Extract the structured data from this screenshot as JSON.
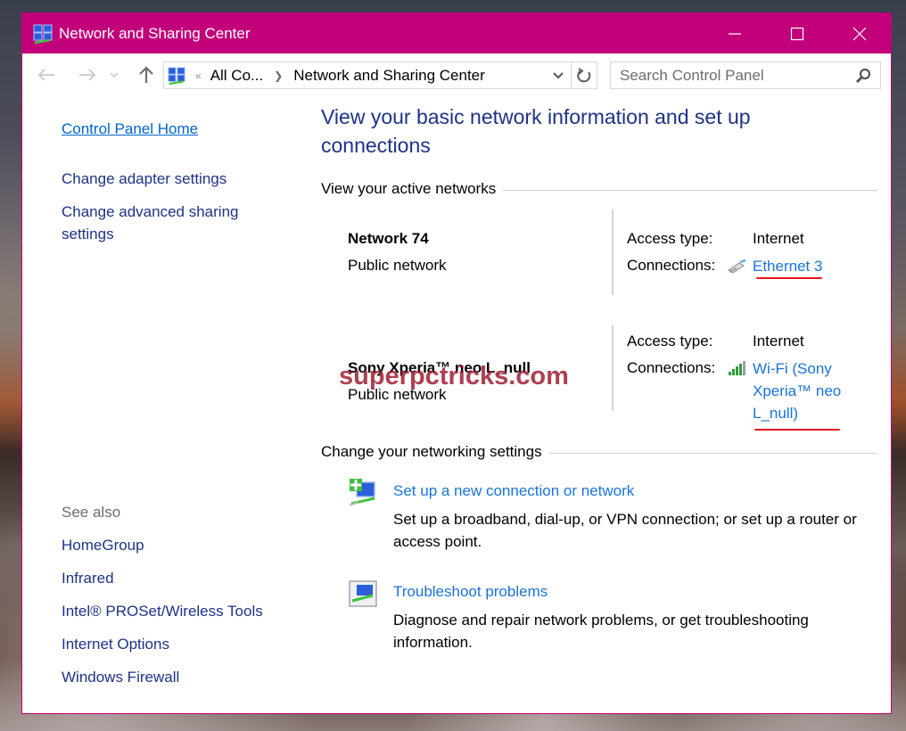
{
  "window": {
    "title": "Network and Sharing Center",
    "controls": {
      "minimize": "minimize",
      "maximize": "maximize",
      "close": "close"
    },
    "accent_color": "#c2007a"
  },
  "navigation": {
    "back_icon": "arrow-left-icon",
    "forward_icon": "arrow-right-icon",
    "recent_icon": "chevron-down-icon",
    "up_icon": "arrow-up-icon",
    "address": {
      "overflow_glyph": "«",
      "crumbs": [
        "All Co...",
        "Network and Sharing Center"
      ]
    },
    "refresh_icon": "refresh-icon",
    "search": {
      "placeholder": "Search Control Panel",
      "value": ""
    }
  },
  "sidebar": {
    "home_link": "Control Panel Home",
    "tasks": [
      {
        "label": "Change adapter settings"
      },
      {
        "label": "Change advanced sharing settings"
      }
    ],
    "see_also": {
      "label": "See also",
      "items": [
        "HomeGroup",
        "Infrared",
        "Intel® PROSet/Wireless Tools",
        "Internet Options",
        "Windows Firewall"
      ]
    }
  },
  "main": {
    "heading": "View your basic network information and set up connections",
    "active_networks_label": "View your active networks",
    "networks": [
      {
        "name": "Network  74",
        "type": "Public network",
        "access_type_label": "Access type:",
        "access_type": "Internet",
        "connections_label": "Connections:",
        "connection_icon": "ethernet-icon",
        "connection": "Ethernet 3"
      },
      {
        "name": "Sony Xperia™ neo L_null",
        "type": "Public network",
        "access_type_label": "Access type:",
        "access_type": "Internet",
        "connections_label": "Connections:",
        "connection_icon": "wifi-signal-icon",
        "connection": "Wi-Fi (Sony Xperia™ neo L_null)"
      }
    ],
    "change_settings_label": "Change your networking settings",
    "tasks": [
      {
        "icon": "new-connection-icon",
        "link": "Set up a new connection or network",
        "description": "Set up a broadband, dial-up, or VPN connection; or set up a router or access point."
      },
      {
        "icon": "troubleshoot-icon",
        "link": "Troubleshoot problems",
        "description": "Diagnose and repair network problems, or get troubleshooting information."
      }
    ]
  },
  "watermark": "superpctricks.com"
}
